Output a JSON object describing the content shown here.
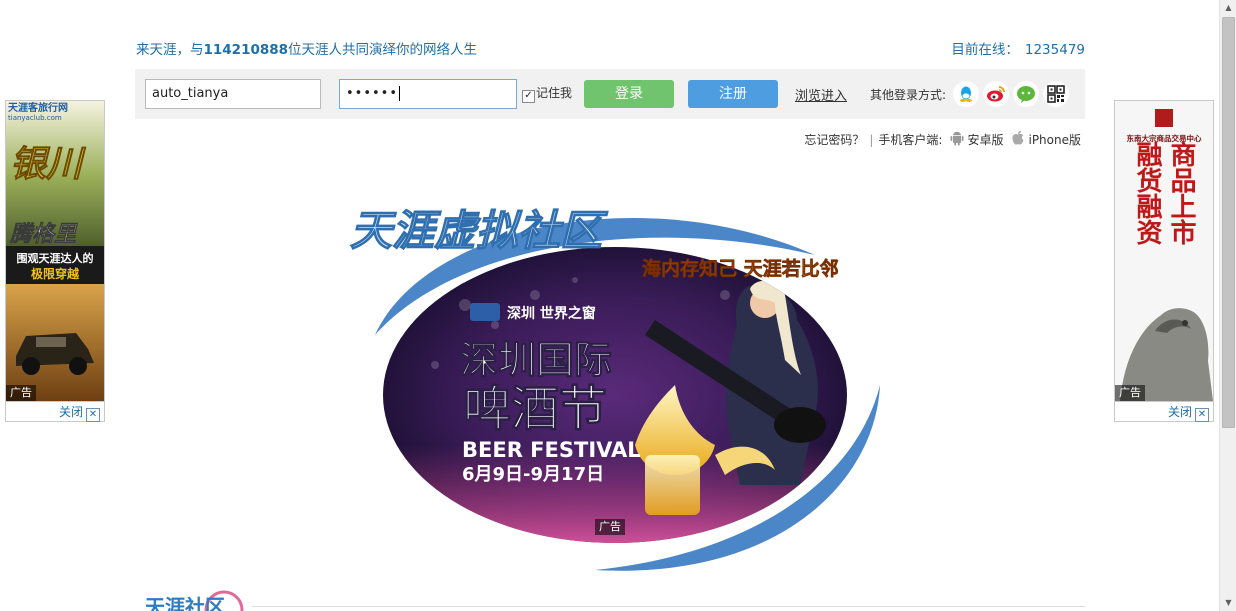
{
  "header": {
    "welcome_prefix": "来天涯，与",
    "user_count": "114210888",
    "welcome_suffix": "位天涯人共同演绎你的网络人生",
    "online_label": "目前在线：",
    "online_count": "1235479"
  },
  "login": {
    "username_value": "auto_tianya",
    "password_mask": "••••••",
    "remember_label": "记住我",
    "remember_checked": true,
    "login_button": "登录",
    "register_button": "注册",
    "browse_link": "浏览进入",
    "other_login_label": "其他登录方式:",
    "social_icons": [
      "qq-icon",
      "weibo-icon",
      "wechat-icon",
      "qrcode-icon"
    ]
  },
  "links": {
    "forgot_password": "忘记密码？",
    "separator": "|",
    "mobile_client": "手机客户端:",
    "android": "安卓版",
    "iphone": "iPhone版"
  },
  "main_ad": {
    "logo_text": "天涯虚拟社区",
    "slogan": "海内存知己 天涯若比邻",
    "sponsor": "深圳 世界之窗",
    "title_line1": "深圳国际",
    "title_line2": "啤酒节",
    "subtitle": "BEER FESTIVAL",
    "dates": "6月9日-9月17日",
    "ad_label": "广告"
  },
  "left_ad": {
    "brand": "天涯客旅行网",
    "brand_url": "tianyaclub.com",
    "headline": "银川",
    "headline2": "腾格里",
    "caption1": "围观天涯达人的",
    "caption2": "极限穿越",
    "ad_label": "广告",
    "close": "关闭"
  },
  "right_ad": {
    "org": "东南大宗商品交易中心",
    "col1": "商品上市",
    "col2": "融货融资",
    "ad_label": "广告",
    "close": "关闭"
  },
  "footer": {
    "logo_text": "天涯社区"
  },
  "colors": {
    "link_blue": "#1f6fa8",
    "login_green": "#6fc46d",
    "register_blue": "#4d9de0",
    "ad_arc_blue": "#4a86c8"
  }
}
